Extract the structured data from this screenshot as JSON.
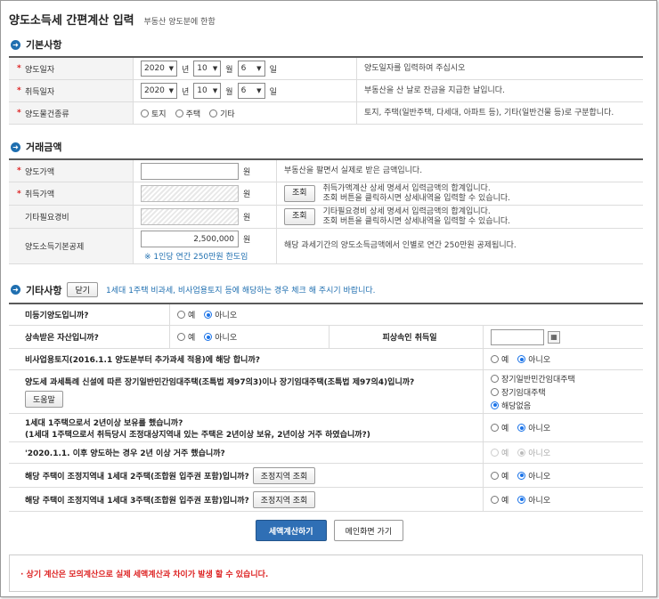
{
  "header": {
    "title": "양도소득세 간편계산 입력",
    "subtitle": "부동산 양도분에 한함"
  },
  "basic": {
    "section_title": "기본사항",
    "transfer_date": {
      "label": "양도일자",
      "year": "2020",
      "month": "10",
      "day": "6",
      "desc": "양도일자를 입력하여 주십시오"
    },
    "acquire_date": {
      "label": "취득일자",
      "year": "2020",
      "month": "10",
      "day": "6",
      "desc": "부동산을 산 날로 잔금을 지급한 날입니다."
    },
    "units": {
      "year": "년",
      "month": "월",
      "day": "일"
    },
    "property_type": {
      "label": "양도물건종류",
      "options": [
        "토지",
        "주택",
        "기타"
      ],
      "desc": "토지, 주택(일반주택, 다세대, 아파트 등), 기타(일반건물 등)로 구분합니다."
    }
  },
  "amount": {
    "section_title": "거래금액",
    "won": "원",
    "lookup_label": "조회",
    "transfer_price": {
      "label": "양도가액",
      "value": "",
      "desc": "부동산을 팔면서 실제로 받은 금액입니다."
    },
    "acquire_price": {
      "label": "취득가액",
      "desc1": "취득가액계산 상세 명세서 입력금액의 합계입니다.",
      "desc2": "조회 버튼을 클릭하시면 상세내역을 입력할 수 있습니다."
    },
    "other_expense": {
      "label": "기타필요경비",
      "desc1": "기타필요경비 상세 명세서 입력금액의 합계입니다.",
      "desc2": "조회 버튼을 클릭하시면 상세내역을 입력할 수 있습니다."
    },
    "basic_deduction": {
      "label": "양도소득기본공제",
      "value": "2,500,000",
      "note": "※ 1인당 연간 250만원 한도임",
      "desc": "해당 과세기간의 양도소득금액에서 인별로 연간 250만원 공제됩니다."
    }
  },
  "other": {
    "section_title": "기타사항",
    "close_label": "닫기",
    "note": "1세대 1주택 비과세, 비사업용토지 등에 해당하는 경우 체크 해 주시기 바랍니다.",
    "yes": "예",
    "no": "아니오",
    "q1": "미등기양도입니까?",
    "q2": "상속받은 자산입니까?",
    "q2_side": "피상속인 취득일",
    "q3": "비사업용토지(2016.1.1 양도분부터 추가과세 적용)에 해당 합니까?",
    "q4": "양도세 과세특례 신설에 따른 장기일반민간임대주택(조특법 제97의3)이나 장기임대주택(조특법 제97의4)입니까?",
    "help_label": "도움말",
    "q4_options": [
      "장기일반민간임대주택",
      "장기임대주택",
      "해당없음"
    ],
    "q5_line1": "1세대 1주택으로서 2년이상 보유를 했습니까?",
    "q5_line2": "(1세대 1주택으로서 취득당시 조정대상지역내 있는 주택은 2년이상 보유, 2년이상 거주 하였습니까?)",
    "q6": "'2020.1.1. 이후 양도하는 경우 2년 이상 거주 했습니까?",
    "q7": "해당 주택이 조정지역내 1세대 2주택(조합원 입주권 포함)입니까?",
    "q8": "해당 주택이 조정지역내 1세대 3주택(조합원 입주권 포함)입니까?",
    "region_lookup_label": "조정지역 조회"
  },
  "actions": {
    "calculate": "세액계산하기",
    "main": "메인화면 가기"
  },
  "notice": "· 상기 계산은 모의계산으로 실제 세액계산과 차이가 발생 할 수 있습니다."
}
